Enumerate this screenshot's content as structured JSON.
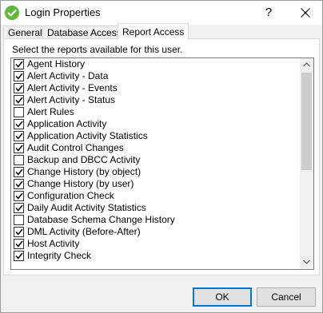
{
  "window": {
    "title": "Login Properties",
    "help_glyph": "?",
    "close_glyph": "X"
  },
  "tabs": [
    {
      "label": "General",
      "active": false
    },
    {
      "label": "Database Access",
      "active": false
    },
    {
      "label": "Report Access",
      "active": true
    }
  ],
  "report_access": {
    "instructions": "Select the reports available for this user.",
    "reports": [
      {
        "label": "Agent History",
        "checked": true
      },
      {
        "label": "Alert Activity - Data",
        "checked": true
      },
      {
        "label": "Alert Activity - Events",
        "checked": true
      },
      {
        "label": "Alert Activity - Status",
        "checked": true
      },
      {
        "label": "Alert Rules",
        "checked": false
      },
      {
        "label": "Application Activity",
        "checked": true
      },
      {
        "label": "Application Activity Statistics",
        "checked": true
      },
      {
        "label": "Audit Control Changes",
        "checked": true
      },
      {
        "label": "Backup and DBCC Activity",
        "checked": false
      },
      {
        "label": "Change History (by object)",
        "checked": true
      },
      {
        "label": "Change History (by user)",
        "checked": true
      },
      {
        "label": "Configuration Check",
        "checked": true
      },
      {
        "label": "Daily Audit Activity Statistics",
        "checked": true
      },
      {
        "label": "Database Schema Change History",
        "checked": false
      },
      {
        "label": "DML Activity (Before-After)",
        "checked": true
      },
      {
        "label": "Host Activity",
        "checked": true
      },
      {
        "label": "Integrity Check",
        "checked": true
      }
    ]
  },
  "buttons": {
    "ok": "OK",
    "cancel": "Cancel"
  },
  "colors": {
    "accent": "#0078d7",
    "app_icon": "#5fb83a"
  },
  "icons": {
    "app": "green-check-circle-icon",
    "close": "close-icon",
    "scroll_up": "chevron-up-icon",
    "scroll_down": "chevron-down-icon"
  }
}
